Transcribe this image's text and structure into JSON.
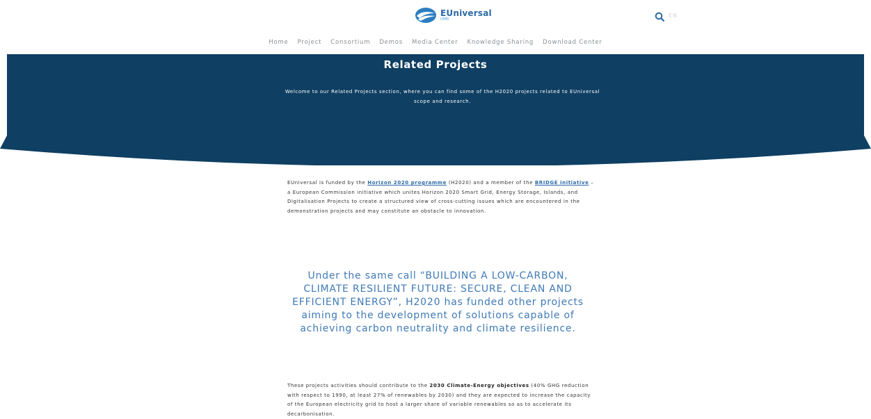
{
  "header": {
    "logo_name": "EUniversal",
    "logo_sub": "UMEI",
    "lang": "EN",
    "icons": {
      "search": "search-icon"
    }
  },
  "nav": {
    "items": [
      "Home",
      "Project",
      "Consortium",
      "Demos",
      "Media Center",
      "Knowledge Sharing",
      "Download Center"
    ]
  },
  "hero": {
    "title": "Related Projects",
    "text": "Welcome to our Related Projects section, where you can find some of the H2020 projects related to EUniversal scope and research.",
    "bg_color": "#0f3f63"
  },
  "intro": {
    "t1": "EUniversal is funded by the ",
    "link1": "Horizon 2020 programme",
    "t2": " (H2020) and a member of the ",
    "link2": "BRIDGE initiative",
    "t3": " – a European Commission initiative which unites Horizon 2020 Smart Grid, Energy Storage, Islands, and Digitalisation Projects to create a structured view of cross-cutting issues which are encountered in the demonstration projects and may constitute an obstacle to innovation."
  },
  "quote": "Under the same call “BUILDING A LOW-CARBON, CLIMATE RESILIENT FUTURE: SECURE, CLEAN AND EFFICIENT ENERGY”, H2020 has funded other projects aiming to the development of solutions capable of achieving carbon neutrality and climate resilience.",
  "objectives": {
    "t1": "These projects activities should contribute to the ",
    "bold": "2030 Climate-Energy objectives",
    "t2": " (40% GHG reduction with respect to 1990, at least 27% of renewables by 2030) and they are expected to increase the capacity of the European electricity grid to host a larger share of variable renewables so as to accelerate its decarbonisation."
  }
}
